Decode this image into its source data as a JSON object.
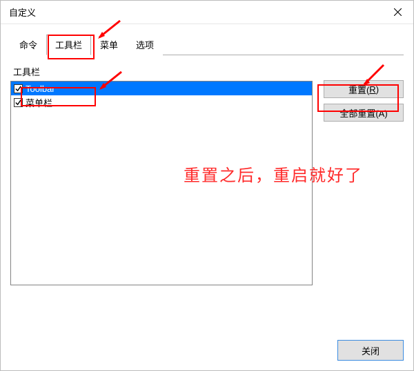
{
  "window": {
    "title": "自定义"
  },
  "tabs": [
    {
      "label": "命令"
    },
    {
      "label": "工具栏"
    },
    {
      "label": "菜单"
    },
    {
      "label": "选项"
    }
  ],
  "group_label": "工具栏",
  "list": [
    {
      "label": "Toolbar",
      "checked": true,
      "selected": true
    },
    {
      "label": "菜单栏",
      "checked": true,
      "selected": false
    }
  ],
  "buttons": {
    "reset_prefix": "重置(",
    "reset_mn": "R",
    "reset_suffix": ")",
    "reset_all": "全部重置(A)",
    "close": "关闭"
  },
  "annotation_text": "重置之后，重启就好了"
}
